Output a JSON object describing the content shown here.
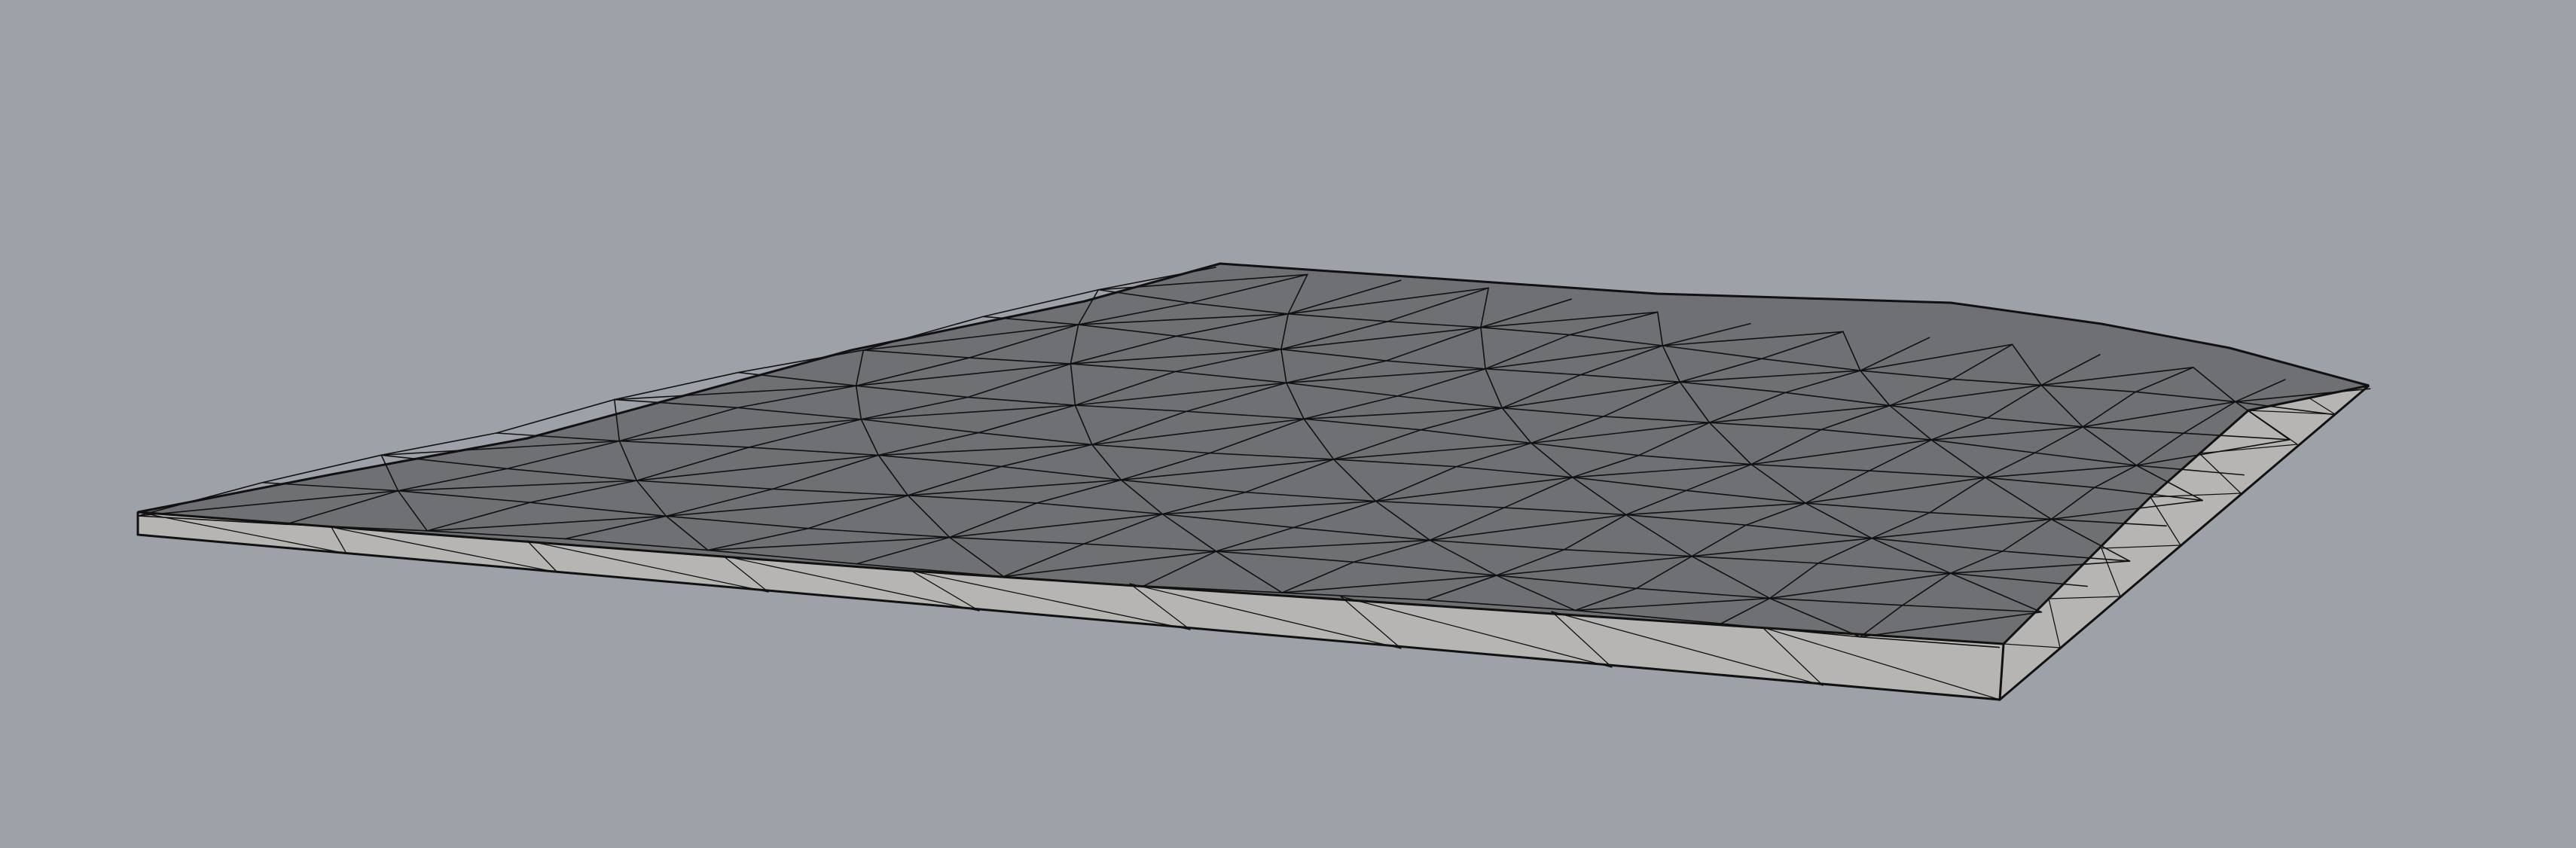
{
  "viewport": {
    "background_color": "#9da2a9",
    "view": "perspective"
  },
  "mesh": {
    "object_type": "triangulated-slab",
    "top_color": "#6e7074",
    "side_color": "#b6b5b3",
    "edge_color": "#111111",
    "wireframe_visible": true
  }
}
